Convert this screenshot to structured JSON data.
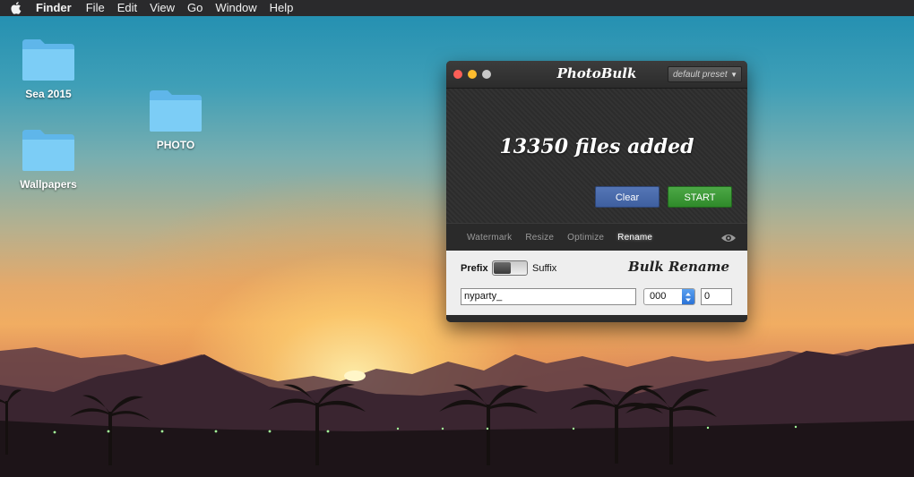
{
  "menubar": {
    "app_name": "Finder",
    "items": [
      "File",
      "Edit",
      "View",
      "Go",
      "Window",
      "Help"
    ]
  },
  "desktop": {
    "icons": [
      {
        "label": "Sea 2015"
      },
      {
        "label": "Wallpapers"
      },
      {
        "label": "PHOTO"
      }
    ]
  },
  "window": {
    "title": "PhotoBulk",
    "preset": "default preset",
    "status": "13350 files added",
    "buttons": {
      "clear": "Clear",
      "start": "START"
    },
    "tabs": [
      {
        "label": "Watermark",
        "active": false
      },
      {
        "label": "Resize",
        "active": false
      },
      {
        "label": "Optimize",
        "active": false
      },
      {
        "label": "Rename",
        "active": true
      }
    ],
    "rename": {
      "heading": "Bulk Rename",
      "prefix_label": "Prefix",
      "suffix_label": "Suffix",
      "mode": "prefix",
      "name_value": "nyparty_",
      "number_format": "000",
      "start_number": "0"
    }
  },
  "colors": {
    "clear_button": "#4a6bad",
    "start_button": "#3a9a35",
    "menubar": "#2a2a2c",
    "close_light": "#fc5f57",
    "minimize_light": "#fdbc2e",
    "zoom_light": "#c8c8c8"
  },
  "icons": {
    "apple": "apple-icon",
    "folder": "folder-icon",
    "eye": "eye-icon",
    "stepper": "up-down-arrows-icon"
  }
}
